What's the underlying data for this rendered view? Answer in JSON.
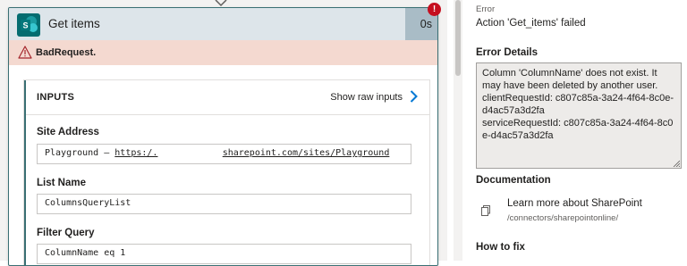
{
  "card": {
    "title": "Get items",
    "duration": "0s",
    "badge": "!",
    "error_label": "BadRequest."
  },
  "inputs": {
    "heading": "INPUTS",
    "raw_link": "Show raw inputs",
    "fields": [
      {
        "label": "Site Address",
        "value_prefix": "Playground – ",
        "value_link_a": "https:/.",
        "value_gap": "            ",
        "value_link_b": "sharepoint.com/sites/Playground"
      },
      {
        "label": "List Name",
        "value": "ColumnsQueryList"
      },
      {
        "label": "Filter Query",
        "value": "ColumnName eq 1"
      }
    ]
  },
  "panel": {
    "error_small": "Error",
    "action_failed": "Action 'Get_items' failed",
    "details_heading": "Error Details",
    "details_lines": [
      "Column 'ColumnName' does not exist. It may have been deleted by another user.",
      "clientRequestId: c807c85a-3a24-4f64-8c0e-d4ac57a3d2fa",
      "serviceRequestId: c807c85a-3a24-4f64-8c0e-d4ac57a3d2fa"
    ],
    "documentation_heading": "Documentation",
    "doc_title": "Learn more about SharePoint",
    "doc_path": "/connectors/sharepointonline/",
    "howto_heading": "How to fix"
  },
  "colors": {
    "accent": "#3a6f73",
    "error_bg": "#f4d9d0",
    "badge": "#c50f1f",
    "link": "#0078d4"
  },
  "icons": [
    "sharepoint-icon",
    "warning-icon",
    "chevron-right-icon",
    "document-icon",
    "resize-grip-icon",
    "connector-arrow-icon"
  ]
}
